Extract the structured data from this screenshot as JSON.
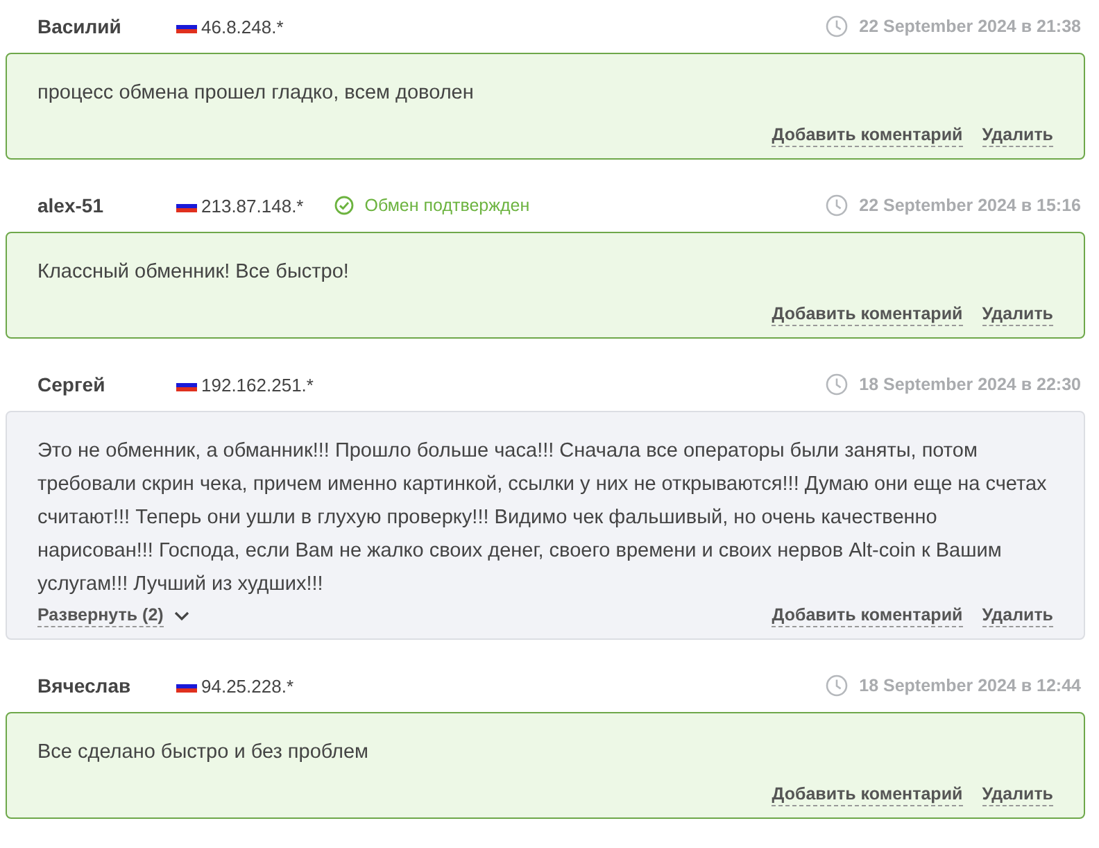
{
  "reviews": [
    {
      "author": "Василий",
      "ip": "46.8.248.*",
      "confirmed": false,
      "date": "22 September 2024 в 21:38",
      "kind": "positive",
      "text": "процесс обмена прошел гладко, всем доволен",
      "actions": [
        "Добавить коментарий",
        "Удалить"
      ]
    },
    {
      "author": "alex-51",
      "ip": "213.87.148.*",
      "confirmed": true,
      "confirmed_label": "Обмен подтвержден",
      "date": "22 September 2024 в 15:16",
      "kind": "positive",
      "text": "Классный обменник! Все быстро!",
      "actions": [
        "Добавить коментарий",
        "Удалить"
      ]
    },
    {
      "author": "Сергей",
      "ip": "192.162.251.*",
      "confirmed": false,
      "date": "18 September 2024 в 22:30",
      "kind": "negative",
      "text": "Это не обменник, а обманник!!! Прошло больше часа!!! Сначала все операторы были заняты, потом требовали скрин чека, причем именно картинкой, ссылки у них не открываются!!! Думаю они еще на счетах считают!!! Теперь они ушли в глухую проверку!!! Видимо чек фальшивый, но очень качественно нарисован!!! Господа, если Вам не жалко своих денег, своего времени и своих нервов Alt-coin к Вашим услугам!!! Лучший из худших!!!",
      "expand": "Развернуть (2)",
      "actions": [
        "Добавить коментарий",
        "Удалить"
      ]
    },
    {
      "author": "Вячеслав",
      "ip": "94.25.228.*",
      "confirmed": false,
      "date": "18 September 2024 в 12:44",
      "kind": "positive",
      "text": "Все сделано быстро и без проблем",
      "actions": [
        "Добавить коментарий",
        "Удалить"
      ]
    }
  ]
}
